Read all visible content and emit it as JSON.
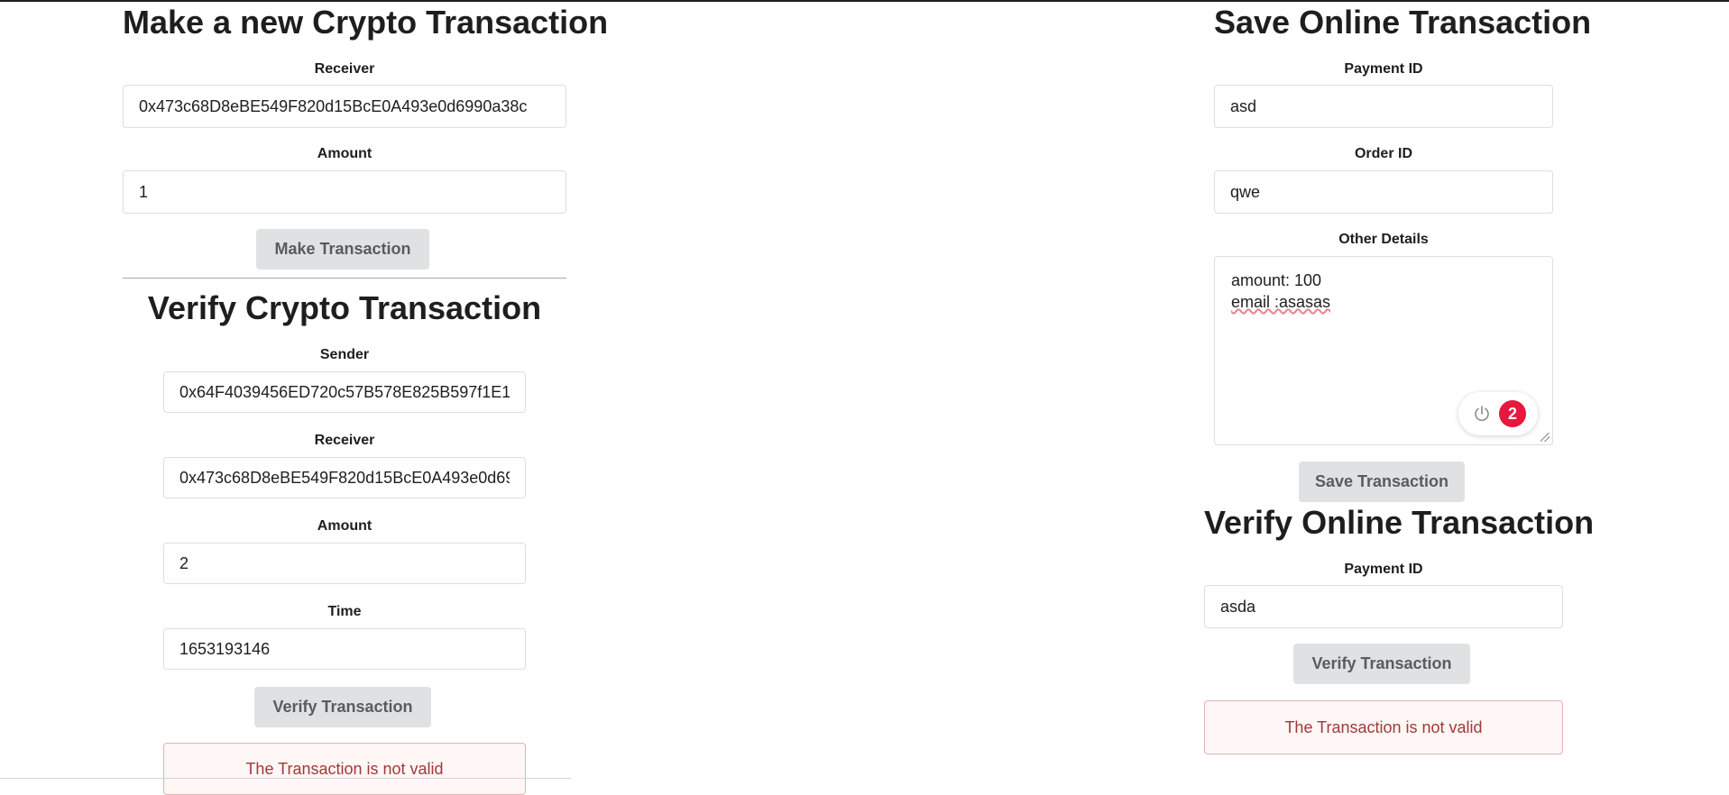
{
  "crypto": {
    "make": {
      "title": "Make a new Crypto Transaction",
      "receiver_label": "Receiver",
      "receiver_value": "0x473c68D8eBE549F820d15BcE0A493e0d6990a38c",
      "amount_label": "Amount",
      "amount_value": "1",
      "button_label": "Make Transaction"
    },
    "verify": {
      "title": "Verify Crypto Transaction",
      "sender_label": "Sender",
      "sender_value": "0x64F4039456ED720c57B578E825B597f1E1",
      "receiver_label": "Receiver",
      "receiver_value": "0x473c68D8eBE549F820d15BcE0A493e0d69",
      "amount_label": "Amount",
      "amount_value": "2",
      "time_label": "Time",
      "time_value": "1653193146",
      "button_label": "Verify Transaction",
      "error_message": "The Transaction is not valid"
    }
  },
  "online": {
    "save": {
      "title": "Save Online Transaction",
      "payment_id_label": "Payment ID",
      "payment_id_value": "asd",
      "order_id_label": "Order ID",
      "order_id_value": "qwe",
      "other_details_label": "Other Details",
      "other_details_line1": "amount: 100",
      "other_details_line2": "email :asasas",
      "grammar_issue_count": "2",
      "button_label": "Save Transaction"
    },
    "verify": {
      "title": "Verify Online Transaction",
      "payment_id_label": "Payment ID",
      "payment_id_value": "asda",
      "button_label": "Verify Transaction",
      "error_message": "The Transaction is not valid"
    }
  },
  "colors": {
    "button_bg": "#e0e1e2",
    "error_bg": "#fff6f6",
    "error_text": "#9f3a38",
    "badge": "#e8173d"
  },
  "icons": {
    "grammar_widget": "power-icon"
  }
}
